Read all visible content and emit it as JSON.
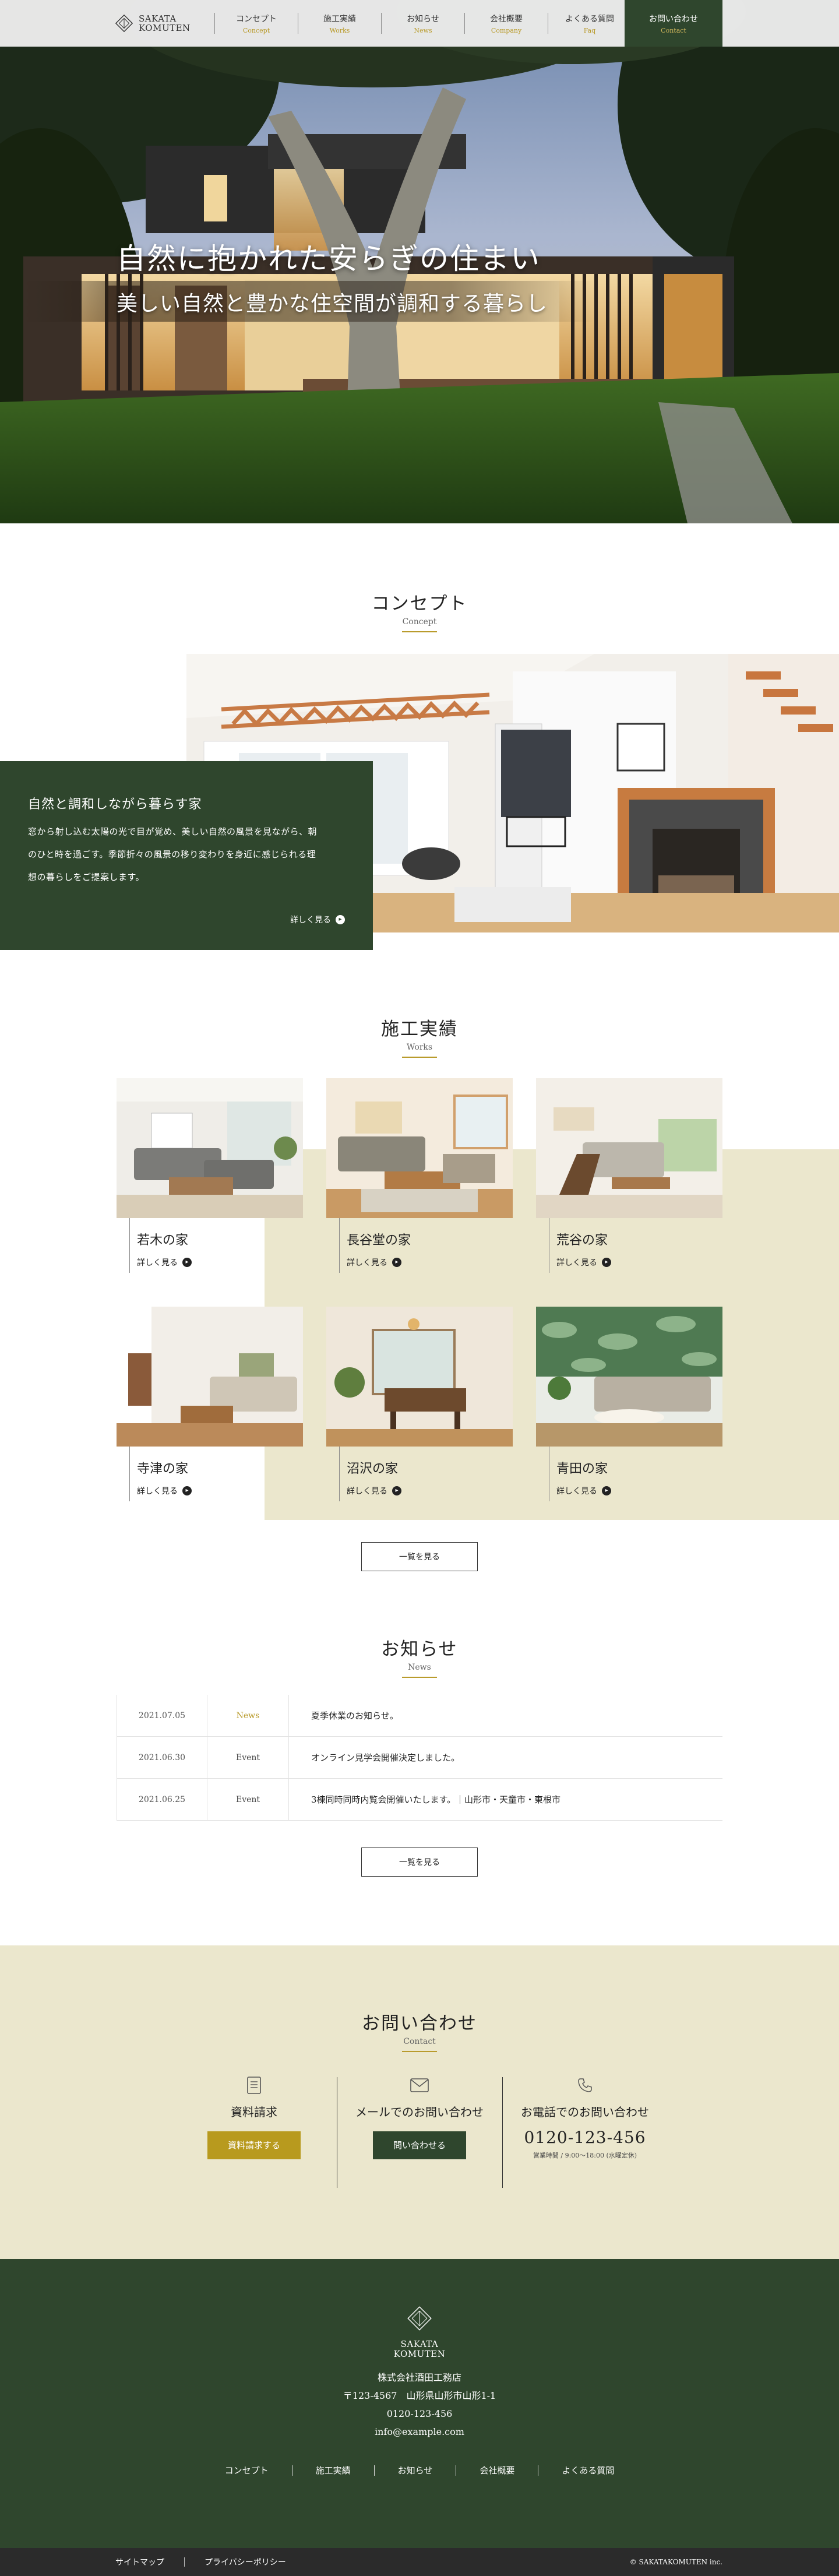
{
  "brand": {
    "logo_line1": "SAKATA",
    "logo_line2": "KOMUTEN"
  },
  "nav": {
    "items": [
      {
        "ja": "コンセプト",
        "en": "Concept"
      },
      {
        "ja": "施工実績",
        "en": "Works"
      },
      {
        "ja": "お知らせ",
        "en": "News"
      },
      {
        "ja": "会社概要",
        "en": "Company"
      },
      {
        "ja": "よくある質問",
        "en": "Faq"
      }
    ],
    "contact": {
      "ja": "お問い合わせ",
      "en": "Contact"
    }
  },
  "hero": {
    "title": "自然に抱かれた安らぎの住まい",
    "subtitle": "美しい自然と豊かな住空間が調和する暮らし"
  },
  "concept": {
    "heading_ja": "コンセプト",
    "heading_en": "Concept",
    "box_title": "自然と調和しながら暮らす家",
    "body_line1": "窓から射し込む太陽の光で目が覚め、美しい自然の風景を見ながら、朝",
    "body_line2": "のひと時を過ごす。季節折々の風景の移り変わりを身近に感じられる理",
    "body_line3": "想の暮らしをご提案します。",
    "more": "詳しく見る"
  },
  "works": {
    "heading_ja": "施工実績",
    "heading_en": "Works",
    "items": [
      {
        "name": "若木の家",
        "more": "詳しく見る"
      },
      {
        "name": "長谷堂の家",
        "more": "詳しく見る"
      },
      {
        "name": "荒谷の家",
        "more": "詳しく見る"
      },
      {
        "name": "寺津の家",
        "more": "詳しく見る"
      },
      {
        "name": "沼沢の家",
        "more": "詳しく見る"
      },
      {
        "name": "青田の家",
        "more": "詳しく見る"
      }
    ],
    "list_button": "一覧を見る"
  },
  "news": {
    "heading_ja": "お知らせ",
    "heading_en": "News",
    "items": [
      {
        "date": "2021.07.05",
        "category": "News",
        "text": "夏季休業のお知らせ。"
      },
      {
        "date": "2021.06.30",
        "category": "Event",
        "text": "オンライン見学会開催決定しました。"
      },
      {
        "date": "2021.06.25",
        "category": "Event",
        "text": "3棟同時同時内覧会開催いたします。｜山形市・天童市・東根市"
      }
    ],
    "list_button": "一覧を見る"
  },
  "contact": {
    "heading_ja": "お問い合わせ",
    "heading_en": "Contact",
    "brochure_label": "資料請求",
    "brochure_button": "資料請求する",
    "mail_label": "メールでのお問い合わせ",
    "mail_button": "問い合わせる",
    "phone_label": "お電話でのお問い合わせ",
    "phone_number": "0120-123-456",
    "phone_hours": "営業時間 / 9:00〜18:00 (水曜定休)"
  },
  "footer": {
    "logo_line1": "SAKATA",
    "logo_line2": "KOMUTEN",
    "company": "株式会社酒田工務店",
    "address": "〒123-4567　山形県山形市山形1-1",
    "tel": "0120-123-456",
    "email": "info@example.com",
    "nav": [
      "コンセプト",
      "施工実績",
      "お知らせ",
      "会社概要",
      "よくある質問"
    ],
    "sitemap": "サイトマップ",
    "privacy": "プライバシーポリシー",
    "copyright": "© SAKATAKOMUTEN inc."
  },
  "colors": {
    "green": "#2f462d",
    "gold": "#b99b2c",
    "beige": "#ebe7cd",
    "button_gold": "#b89a1e"
  }
}
